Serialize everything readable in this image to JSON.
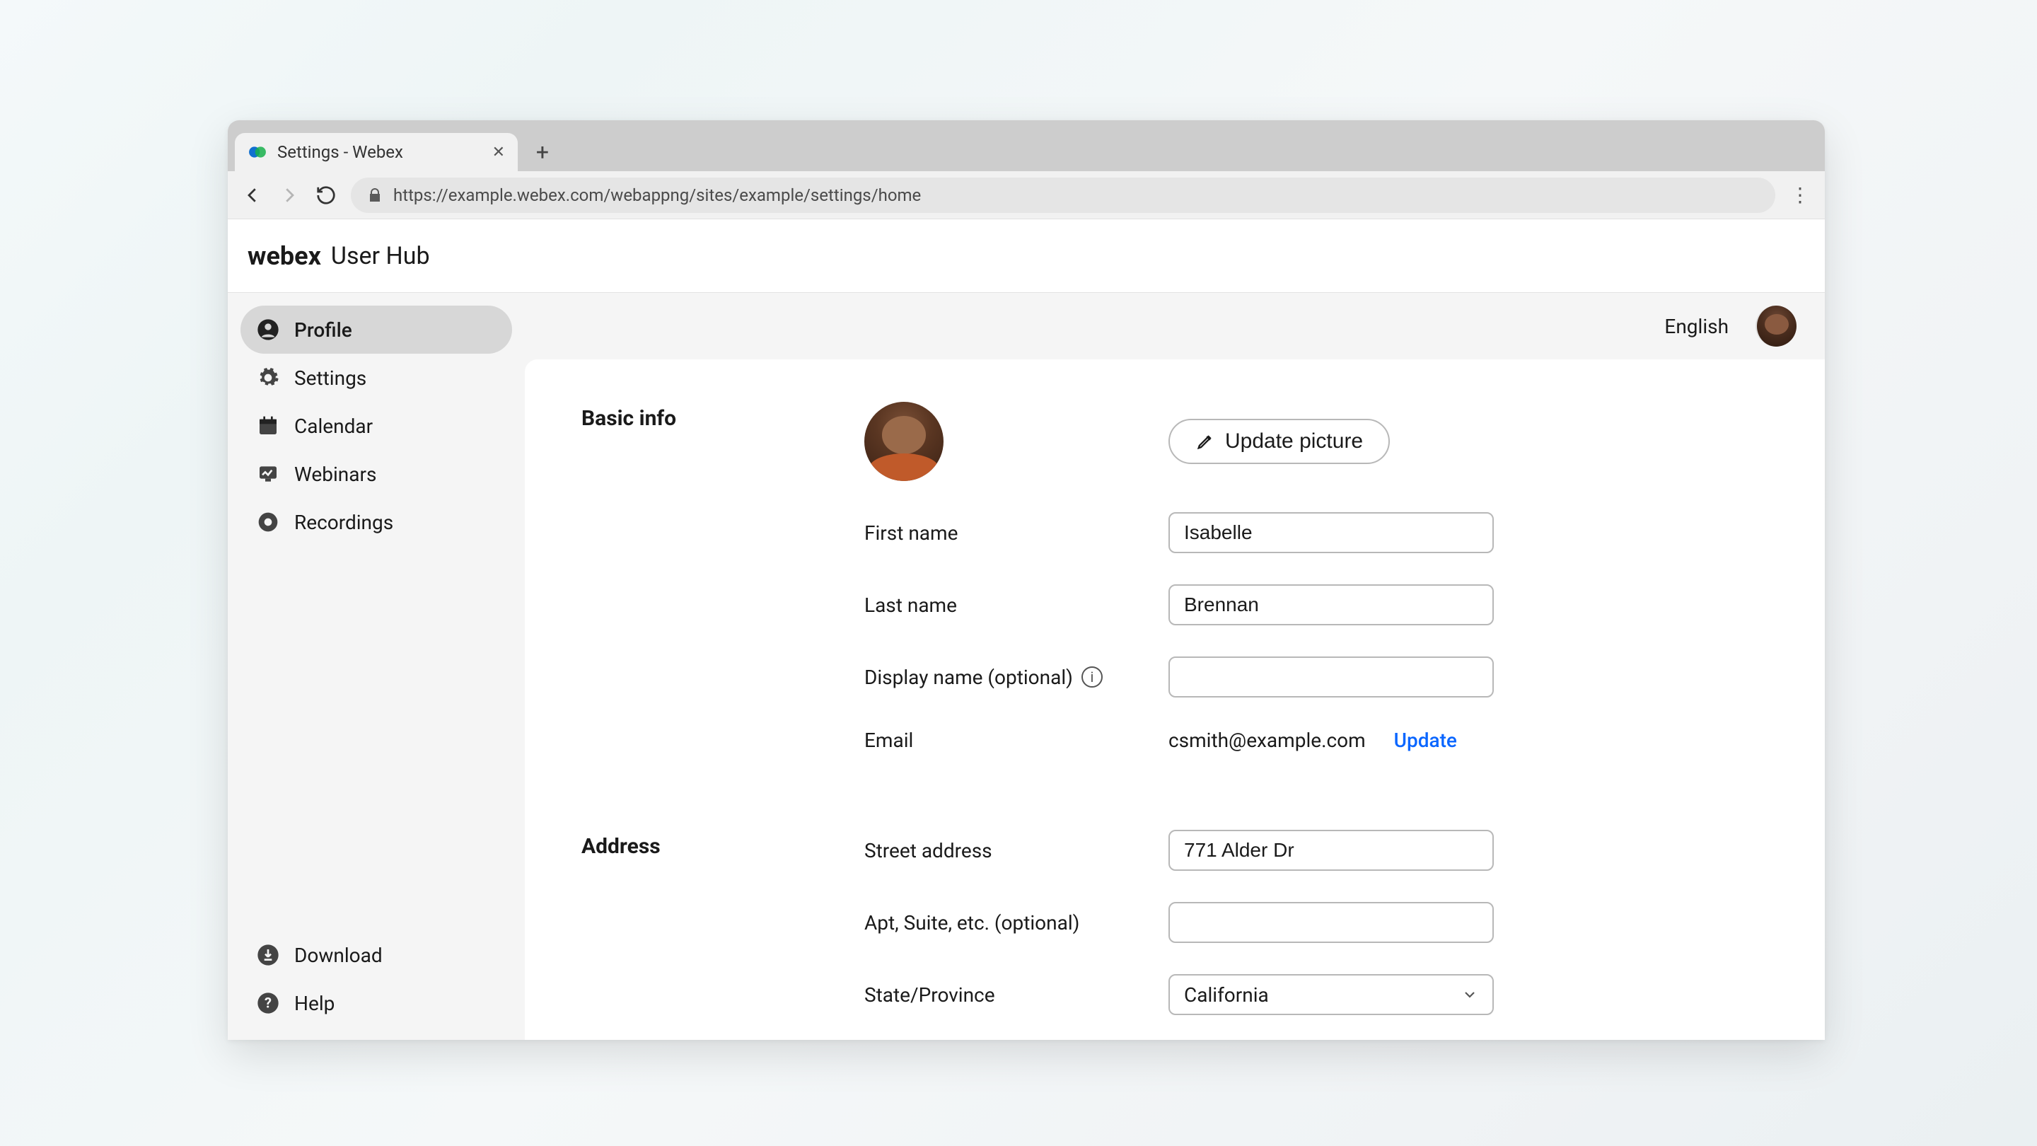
{
  "browser": {
    "tab_title": "Settings - Webex",
    "url": "https://example.webex.com/webappng/sites/example/settings/home"
  },
  "header": {
    "brand": "webex",
    "subtitle": "User Hub"
  },
  "sidebar": {
    "items": [
      {
        "label": "Profile",
        "icon": "person"
      },
      {
        "label": "Settings",
        "icon": "gear"
      },
      {
        "label": "Calendar",
        "icon": "calendar"
      },
      {
        "label": "Webinars",
        "icon": "chart"
      },
      {
        "label": "Recordings",
        "icon": "record"
      }
    ],
    "footer": [
      {
        "label": "Download",
        "icon": "download"
      },
      {
        "label": "Help",
        "icon": "help"
      }
    ]
  },
  "topbar": {
    "language": "English"
  },
  "profile": {
    "basic_info_heading": "Basic info",
    "update_picture_label": "Update picture",
    "first_name_label": "First name",
    "first_name_value": "Isabelle",
    "last_name_label": "Last name",
    "last_name_value": "Brennan",
    "display_name_label": "Display name (optional)",
    "display_name_value": "",
    "email_label": "Email",
    "email_value": "csmith@example.com",
    "email_update_label": "Update",
    "address_heading": "Address",
    "street_label": "Street address",
    "street_value": "771 Alder Dr",
    "apt_label": "Apt, Suite, etc. (optional)",
    "apt_value": "",
    "state_label": "State/Province",
    "state_value": "California"
  }
}
